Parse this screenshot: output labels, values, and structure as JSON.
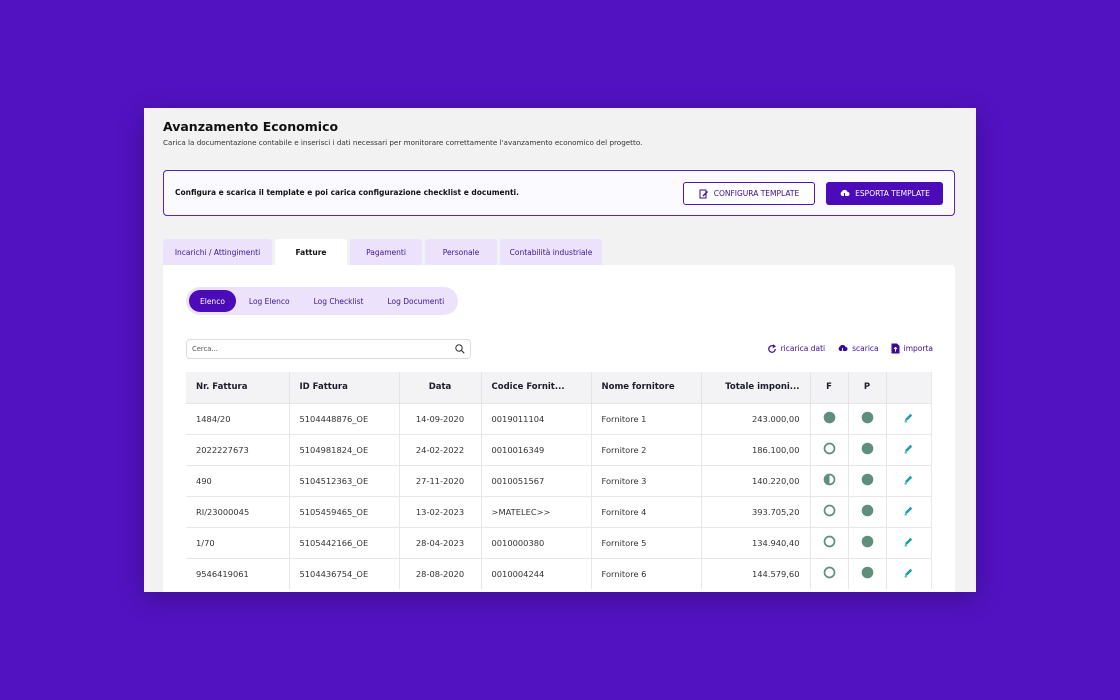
{
  "header": {
    "title": "Avanzamento Economico",
    "subtitle": "Carica la documentazione contabile e inserisci i dati necessari per monitorare correttamente l'avanzamento economico del progetto."
  },
  "config": {
    "text": "Configura e scarica il template e poi carica configurazione checklist e documenti.",
    "configure_label": "CONFIGURA TEMPLATE",
    "export_label": "ESPORTA TEMPLATE"
  },
  "tabs": [
    {
      "label": "Incarichi / Attingimenti",
      "active": false
    },
    {
      "label": "Fatture",
      "active": true
    },
    {
      "label": "Pagamenti",
      "active": false
    },
    {
      "label": "Personale",
      "active": false
    },
    {
      "label": "Contabilità industriale",
      "active": false
    }
  ],
  "subtabs": [
    {
      "label": "Elenco",
      "active": true
    },
    {
      "label": "Log Elenco",
      "active": false
    },
    {
      "label": "Log Checklist",
      "active": false
    },
    {
      "label": "Log Documenti",
      "active": false
    }
  ],
  "search": {
    "placeholder": "Cerca..."
  },
  "actions": {
    "reload_label": "ricarica dati",
    "download_label": "scarica",
    "import_label": "importa"
  },
  "table": {
    "columns": [
      "Nr. Fattura",
      "ID Fattura",
      "Data",
      "Codice Fornit...",
      "Nome fornitore",
      "Totale imponi...",
      "F",
      "P",
      ""
    ],
    "rows": [
      {
        "nr": "1484/20",
        "id": "5104448876_OE",
        "data": "14-09-2020",
        "codice": "0019011104",
        "nome": "Fornitore 1",
        "totale": "243.000,00",
        "f": "full",
        "p": "full"
      },
      {
        "nr": "2022227673",
        "id": "5104981824_OE",
        "data": "24-02-2022",
        "codice": "0010016349",
        "nome": "Fornitore 2",
        "totale": "186.100,00",
        "f": "empty",
        "p": "full"
      },
      {
        "nr": "490",
        "id": "5104512363_OE",
        "data": "27-11-2020",
        "codice": "0010051567",
        "nome": "Fornitore 3",
        "totale": "140.220,00",
        "f": "half",
        "p": "full"
      },
      {
        "nr": "RI/23000045",
        "id": "5105459465_OE",
        "data": "13-02-2023",
        "codice": ">MATELEC>>",
        "nome": "Fornitore 4",
        "totale": "393.705,20",
        "f": "empty",
        "p": "full"
      },
      {
        "nr": "1/70",
        "id": "5105442166_OE",
        "data": "28-04-2023",
        "codice": "0010000380",
        "nome": "Fornitore 5",
        "totale": "134.940,40",
        "f": "empty",
        "p": "full"
      },
      {
        "nr": "9546419061",
        "id": "5104436754_OE",
        "data": "28-08-2020",
        "codice": "0010004244",
        "nome": "Fornitore 6",
        "totale": "144.579,60",
        "f": "empty",
        "p": "full"
      }
    ]
  },
  "colors": {
    "background": "#5212c1",
    "accent": "#4b0bb8",
    "status": "#5e8f7d",
    "edit": "#1a9fb0"
  }
}
